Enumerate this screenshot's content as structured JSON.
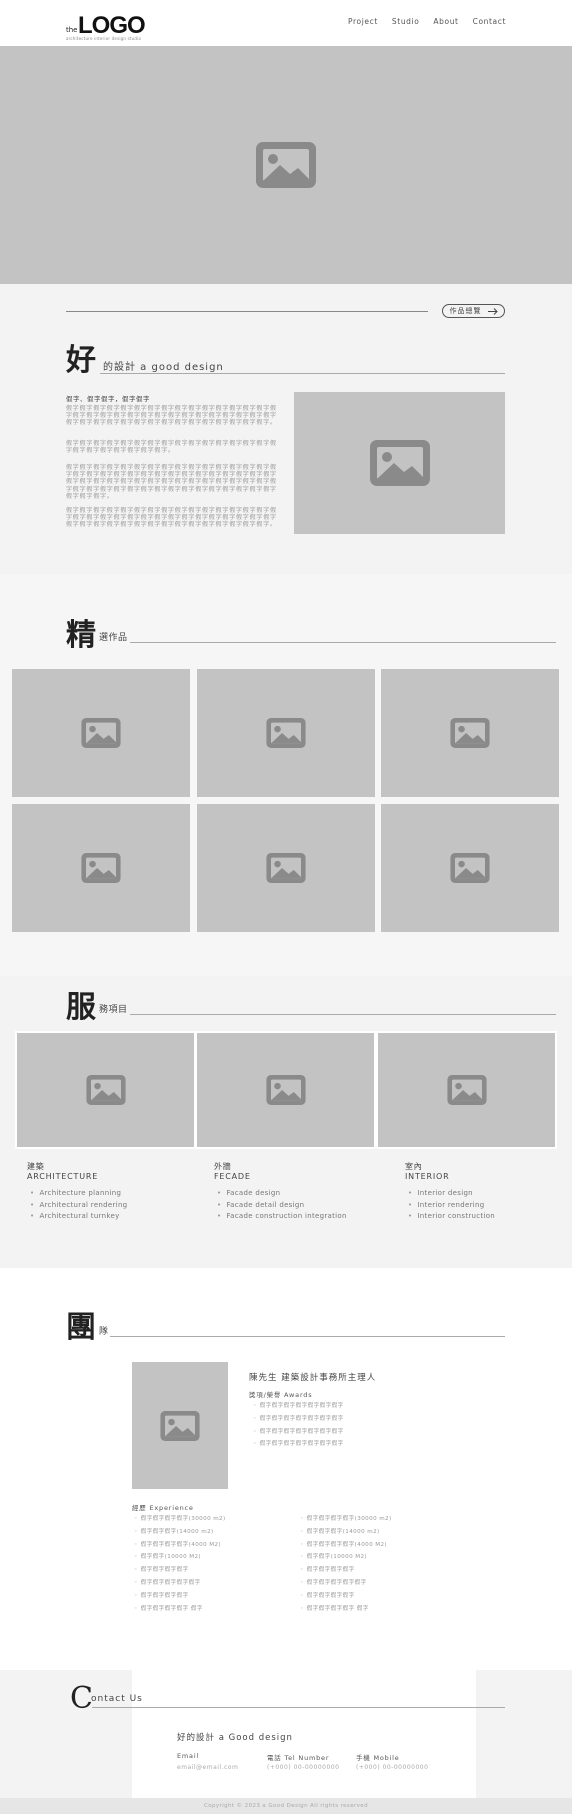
{
  "header": {
    "logo_prefix": "the",
    "logo_word": "LOGO",
    "logo_tagline": "architecture interior design studio",
    "nav": [
      "Project",
      "Studio",
      "About",
      "Contact"
    ]
  },
  "intro": {
    "more_label": "作品總覽",
    "big_char": "好",
    "title": "的設計 a good design",
    "headline": "假字、假字假字，假字假字",
    "paragraphs": [
      "假字假字假字假字假字假字假字假字假字假字假字假字假字假字假字假字假字假字假字假字假字假字假字假字假字假字假字假字假字假字假字假字假字假字假字假字假字假字假字假字假字假字假字假字假字假字。",
      "假字假字假字假字假字假字假字假字假字假字假字假字假字假字假字假字假字假字假字假字假字假字假字。",
      "假字假字假字假字假字假字假字假字假字假字假字假字假字假字假字假字假字假字假字假字假字假字假字假字假字假字假字假字假字假字假字假字假字假字假字假字假字假字假字假字假字假字假字假字假字假字假字假字假字假字假字假字假字假字假字假字假字假字假字假字假字假字假字假字假字。",
      "假字假字假字假字假字假字假字假字假字假字假字假字假字假字假字假字假字假字假字假字假字假字假字假字假字假字假字假字假字假字假字假字假字假字假字假字假字假字假字假字假字假字假字假字假字假字。"
    ]
  },
  "selected": {
    "big_char": "精",
    "title": "選作品"
  },
  "services": {
    "big_char": "服",
    "title": "務項目",
    "columns": [
      {
        "zh": "建築",
        "en": "ARCHITECTURE",
        "items": [
          "Architecture planning",
          "Architectural rendering",
          "Architectural turnkey"
        ]
      },
      {
        "zh": "外牆",
        "en": "FECADE",
        "items": [
          "Facade design",
          "Facade detail design",
          "Facade construction integration"
        ]
      },
      {
        "zh": "室內",
        "en": "INTERIOR",
        "items": [
          "Interior design",
          "Interior rendering",
          "Interior construction"
        ]
      }
    ]
  },
  "team": {
    "big_char": "團",
    "title": "隊",
    "name": "陳先生  建築設計事務所主理人",
    "awards_title": "獎項/榮譽  Awards",
    "awards": [
      "假字假字假字假字假字假字假字",
      "假字假字假字假字假字假字假字",
      "假字假字假字假字假字假字假字",
      "假字假字假字假字假字假字假字"
    ],
    "experience_title": "經歷  Experience",
    "exp_left": [
      "假字假字假字假字(30000 m2)",
      "假字假字假字(14000 m2)",
      "假字假字假字假字(4000 M2)",
      "假字假字(10000 M2)",
      "假字假字假字假字",
      "假字假字假字假字假字",
      "假字假字假字假字",
      "假字假字假字假字 假字"
    ],
    "exp_right": [
      "假字假字假字假字(30000 m2)",
      "假字假字假字(14000 m2)",
      "假字假字假字假字(4000 M2)",
      "假字假字(10000 M2)",
      "假字假字假字假字",
      "假字假字假字假字假字",
      "假字假字假字假字",
      "假字假字假字假字 假字"
    ]
  },
  "contact": {
    "big_char": "C",
    "title": "ontact Us",
    "company": "好的設計 a Good design",
    "email_label": "Email",
    "email_value": "email@email.com",
    "tel_label": "電話 Tel Number",
    "tel_value": "(+000) 00-00000000",
    "mobile_label": "手機 Mobile",
    "mobile_value": "(+000) 00-00000000"
  },
  "footer": {
    "copyright": "Copyright © 2023 a Good Design All rights reserved"
  },
  "colors": {
    "placeholder": "#c3c3c3",
    "icon": "#8a8a8a",
    "section_bg": "#f3f3f3"
  }
}
